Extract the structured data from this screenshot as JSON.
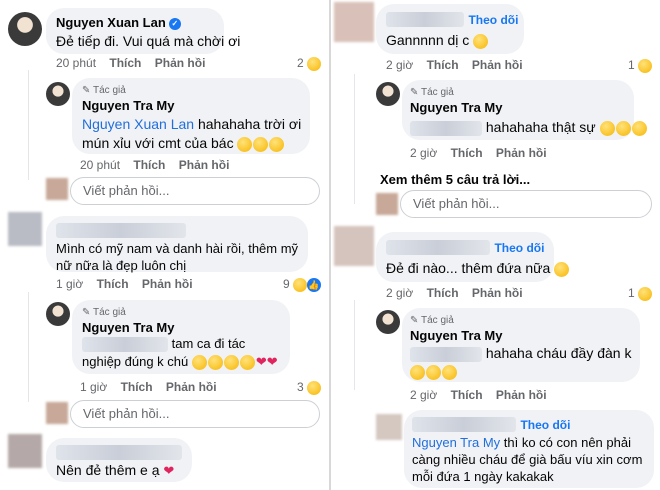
{
  "labels": {
    "like": "Thích",
    "reply": "Phản hồi",
    "author_badge": "Tác giả",
    "follow": "Theo dõi",
    "reply_placeholder": "Viết phản hồi..."
  },
  "left": {
    "c1": {
      "name": "Nguyen Xuan Lan",
      "text": "Đẻ tiếp đi. Vui quá mà chời ơi",
      "time": "20 phút",
      "react_count": "2"
    },
    "r1": {
      "name": "Nguyen Tra My",
      "tag": "Nguyen Xuan Lan",
      "text": " hahahaha trời ơi mún xỉu với cmt của bác",
      "time": "20 phút"
    },
    "c2": {
      "text": "Mình có mỹ nam và danh hài rồi, thêm mỹ nữ nữa là đẹp luôn chị",
      "time": "1 giờ",
      "react_count": "9"
    },
    "r2": {
      "name": "Nguyen Tra My",
      "text": " tam ca đi tác nghiệp đúng k chú",
      "time": "1 giờ",
      "react_count": "3"
    },
    "c3": {
      "text": "Nên đẻ thêm e ạ"
    }
  },
  "right": {
    "c1": {
      "text": "Gannnnn dị c",
      "time": "2 giờ",
      "react_count": "1"
    },
    "r1": {
      "name": "Nguyen Tra My",
      "text": "hahahaha thật sự",
      "time": "2 giờ"
    },
    "see_more": "Xem thêm 5 câu trả lời...",
    "c2": {
      "text": "Đẻ đi nào... thêm đứa nữa",
      "time": "2 giờ",
      "react_count": "1"
    },
    "r2": {
      "name": "Nguyen Tra My",
      "text": "hahaha cháu đầy đàn k",
      "time": "2 giờ"
    },
    "c3": {
      "tag": "Nguyen Tra My",
      "text": " thì ko có con nên phải càng nhiều cháu để già bấu víu xin cơm mỗi đứa 1 ngày kakakak"
    }
  },
  "colors": {
    "bubble": "#f0f2f5",
    "link": "#216fdb",
    "follow": "#1877f2",
    "meta": "#65676b"
  },
  "icons": {
    "verified": "verified-badge-icon",
    "haha": "haha-reaction-icon",
    "like": "like-reaction-icon",
    "pencil": "pencil-icon",
    "heart": "heart-emoji"
  }
}
